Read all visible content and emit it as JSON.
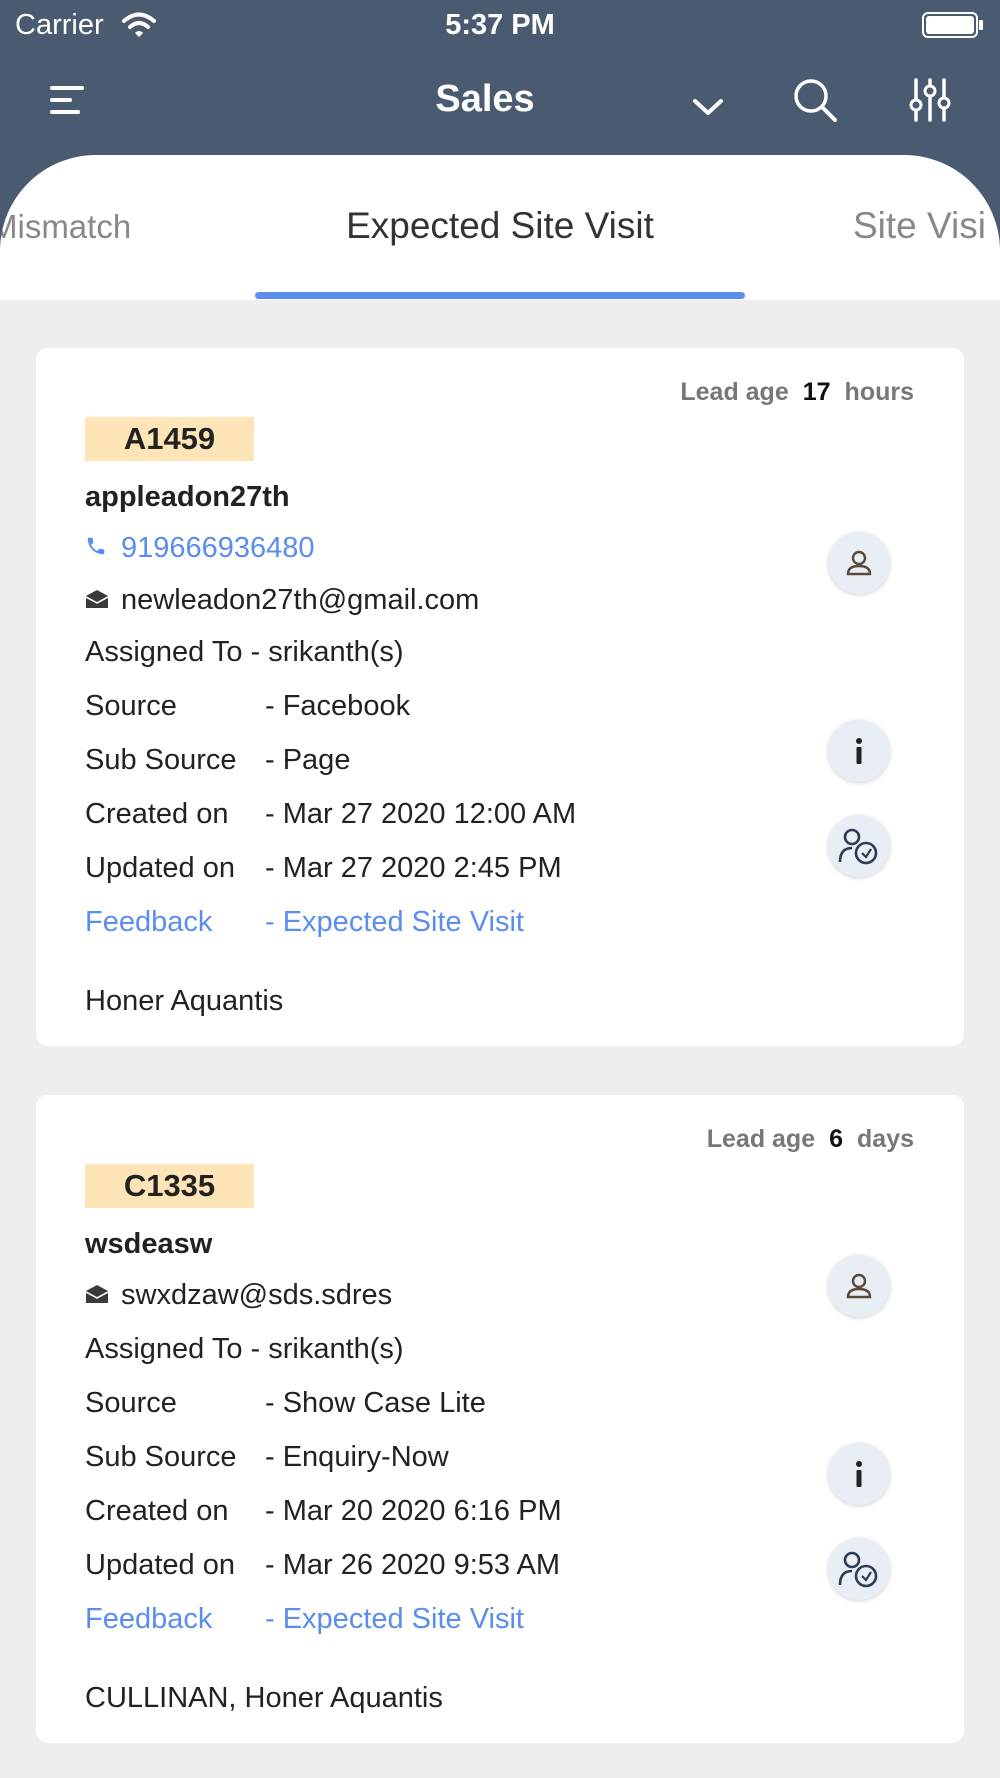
{
  "status_bar": {
    "carrier": "Carrier",
    "time": "5:37 PM"
  },
  "header": {
    "title": "Sales",
    "icons": {
      "menu": "menu-icon",
      "dropdown": "chevron-down-icon",
      "search": "search-icon",
      "filter": "sliders-icon"
    },
    "colors": {
      "background": "#4a5a70",
      "accent": "#5b8dee"
    }
  },
  "tabs": [
    {
      "label": "Mismatch"
    },
    {
      "label": "Expected Site Visit",
      "active": true
    },
    {
      "label": "Site Visi"
    }
  ],
  "leads": [
    {
      "lead_age_label": "Lead age",
      "lead_age_value": "17",
      "lead_age_unit": "hours",
      "code": "A1459",
      "name": "appleadon27th",
      "phone": "919666936480",
      "email": "newleadon27th@gmail.com",
      "assigned": "Assigned To - srikanth(s)",
      "source_label": "Source",
      "source_value": "- Facebook",
      "sub_source_label": "Sub Source",
      "sub_source_value": "- Page",
      "created_label": "Created on",
      "created_value": "- Mar 27 2020 12:00 AM",
      "updated_label": "Updated on",
      "updated_value": "- Mar 27 2020 2:45 PM",
      "feedback_label": "Feedback",
      "feedback_value": "- Expected Site Visit",
      "project": "Honer Aquantis"
    },
    {
      "lead_age_label": "Lead age",
      "lead_age_value": "6",
      "lead_age_unit": "days",
      "code": "C1335",
      "name": "wsdeasw",
      "email": "swxdzaw@sds.sdres",
      "assigned": "Assigned To - srikanth(s)",
      "source_label": "Source",
      "source_value": "- Show Case Lite",
      "sub_source_label": "Sub Source",
      "sub_source_value": "- Enquiry-Now",
      "created_label": "Created on",
      "created_value": "- Mar 20 2020 6:16 PM",
      "updated_label": "Updated on",
      "updated_value": "- Mar 26 2020 9:53 AM",
      "feedback_label": "Feedback",
      "feedback_value": "- Expected Site Visit",
      "project": "CULLINAN, Honer Aquantis"
    }
  ]
}
